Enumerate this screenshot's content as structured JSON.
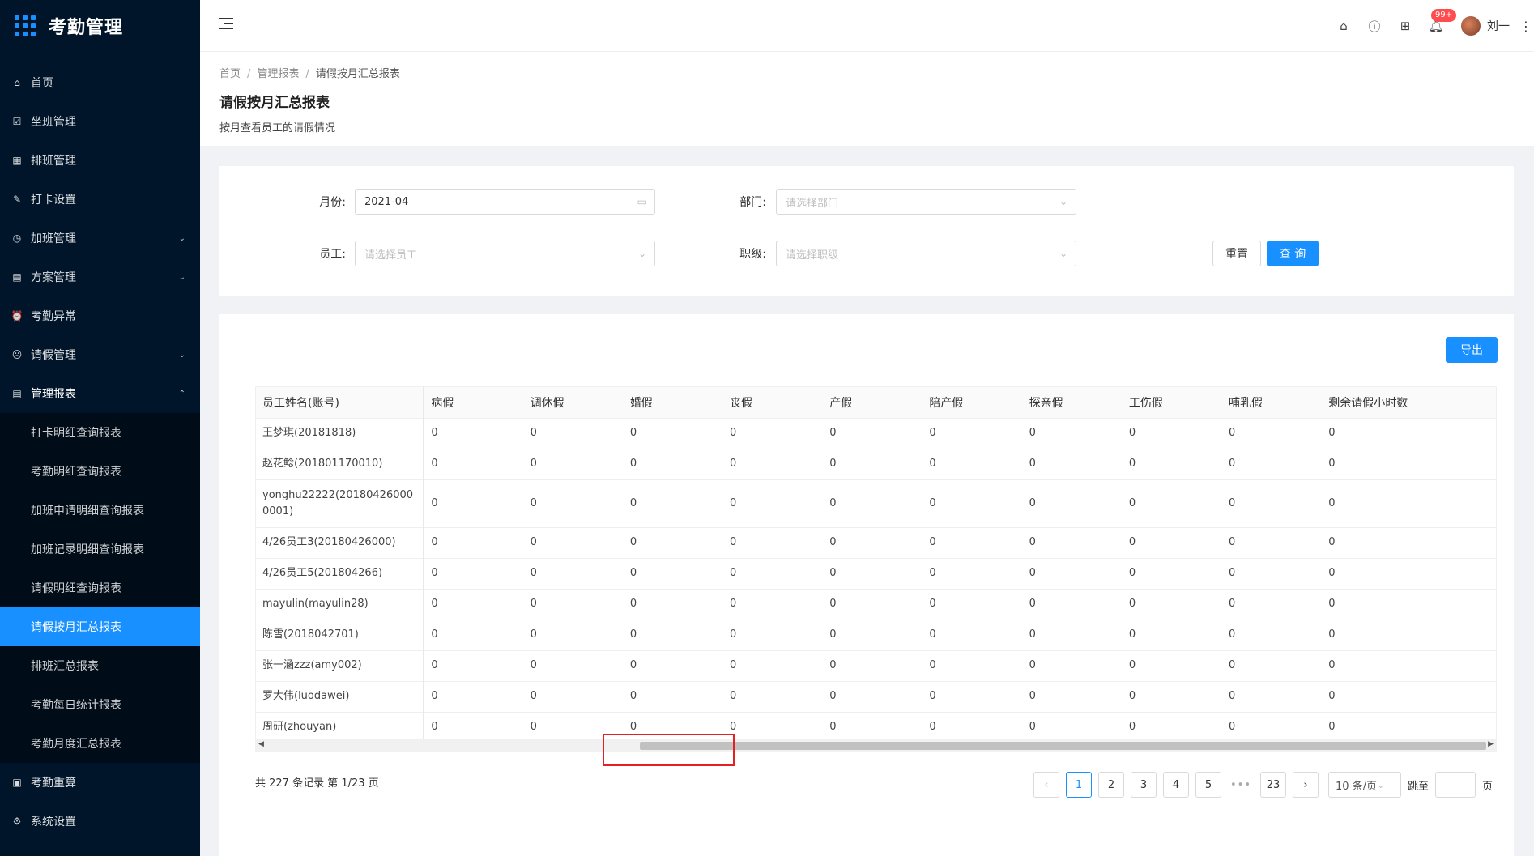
{
  "app": {
    "title": "考勤管理"
  },
  "sidebar": {
    "items": [
      {
        "label": "首页",
        "icon": "home-icon",
        "glyph": "⌂"
      },
      {
        "label": "坐班管理",
        "icon": "calendar-check-icon",
        "glyph": "☑"
      },
      {
        "label": "排班管理",
        "icon": "schedule-icon",
        "glyph": "▦"
      },
      {
        "label": "打卡设置",
        "icon": "edit-icon",
        "glyph": "✎"
      },
      {
        "label": "加班管理",
        "icon": "clock-icon",
        "glyph": "◷",
        "arrow": "⌄"
      },
      {
        "label": "方案管理",
        "icon": "document-icon",
        "glyph": "▤",
        "arrow": "⌄"
      },
      {
        "label": "考勤异常",
        "icon": "alarm-icon",
        "glyph": "⏰"
      },
      {
        "label": "请假管理",
        "icon": "leave-icon",
        "glyph": "☹",
        "arrow": "⌄"
      },
      {
        "label": "管理报表",
        "icon": "report-icon",
        "glyph": "▤",
        "arrow": "⌃"
      }
    ],
    "sub_items": [
      "打卡明细查询报表",
      "考勤明细查询报表",
      "加班申请明细查询报表",
      "加班记录明细查询报表",
      "请假明细查询报表",
      "请假按月汇总报表",
      "排班汇总报表",
      "考勤每日统计报表",
      "考勤月度汇总报表"
    ],
    "bottom_items": [
      {
        "label": "考勤重算",
        "icon": "recalc-icon",
        "glyph": "▣"
      },
      {
        "label": "系统设置",
        "icon": "settings-icon",
        "glyph": "⚙"
      }
    ]
  },
  "header": {
    "badge": "99+",
    "user_name": "刘一"
  },
  "page": {
    "breadcrumb": [
      "首页",
      "管理报表",
      "请假按月汇总报表"
    ],
    "title": "请假按月汇总报表",
    "description": "按月查看员工的请假情况"
  },
  "filters": {
    "month_label": "月份:",
    "month_value": "2021-04",
    "dept_label": "部门:",
    "dept_placeholder": "请选择部门",
    "employee_label": "员工:",
    "employee_placeholder": "请选择员工",
    "level_label": "职级:",
    "level_placeholder": "请选择职级",
    "reset_label": "重置",
    "query_label": "查 询"
  },
  "toolbar": {
    "export_label": "导出"
  },
  "table": {
    "columns": [
      "员工姓名(账号)",
      "病假",
      "调休假",
      "婚假",
      "丧假",
      "产假",
      "陪产假",
      "探亲假",
      "工伤假",
      "哺乳假",
      "剩余请假小时数"
    ],
    "rows": [
      [
        "王梦琪(20181818)",
        "0",
        "0",
        "0",
        "0",
        "0",
        "0",
        "0",
        "0",
        "0",
        "0"
      ],
      [
        "赵花鲶(201801170010)",
        "0",
        "0",
        "0",
        "0",
        "0",
        "0",
        "0",
        "0",
        "0",
        "0"
      ],
      [
        "yonghu22222(201804260000001)",
        "0",
        "0",
        "0",
        "0",
        "0",
        "0",
        "0",
        "0",
        "0",
        "0"
      ],
      [
        "4/26员工3(20180426000)",
        "0",
        "0",
        "0",
        "0",
        "0",
        "0",
        "0",
        "0",
        "0",
        "0"
      ],
      [
        "4/26员工5(201804266)",
        "0",
        "0",
        "0",
        "0",
        "0",
        "0",
        "0",
        "0",
        "0",
        "0"
      ],
      [
        "mayulin(mayulin28)",
        "0",
        "0",
        "0",
        "0",
        "0",
        "0",
        "0",
        "0",
        "0",
        "0"
      ],
      [
        "陈雪(2018042701)",
        "0",
        "0",
        "0",
        "0",
        "0",
        "0",
        "0",
        "0",
        "0",
        "0"
      ],
      [
        "张一涵zzz(amy002)",
        "0",
        "0",
        "0",
        "0",
        "0",
        "0",
        "0",
        "0",
        "0",
        "0"
      ],
      [
        "罗大伟(luodawei)",
        "0",
        "0",
        "0",
        "0",
        "0",
        "0",
        "0",
        "0",
        "0",
        "0"
      ],
      [
        "周研(zhouyan)",
        "0",
        "0",
        "0",
        "0",
        "0",
        "0",
        "0",
        "0",
        "0",
        "0"
      ]
    ]
  },
  "pagination": {
    "summary": "共 227 条记录 第 1/23 页",
    "pages": [
      "1",
      "2",
      "3",
      "4",
      "5"
    ],
    "ellipsis": "•••",
    "last_page": "23",
    "page_size": "10 条/页",
    "jump_label": "跳至",
    "page_unit": "页"
  },
  "colors": {
    "sidebar_bg": "#001529",
    "accent": "#1890ff",
    "highlight": "#e52020"
  }
}
